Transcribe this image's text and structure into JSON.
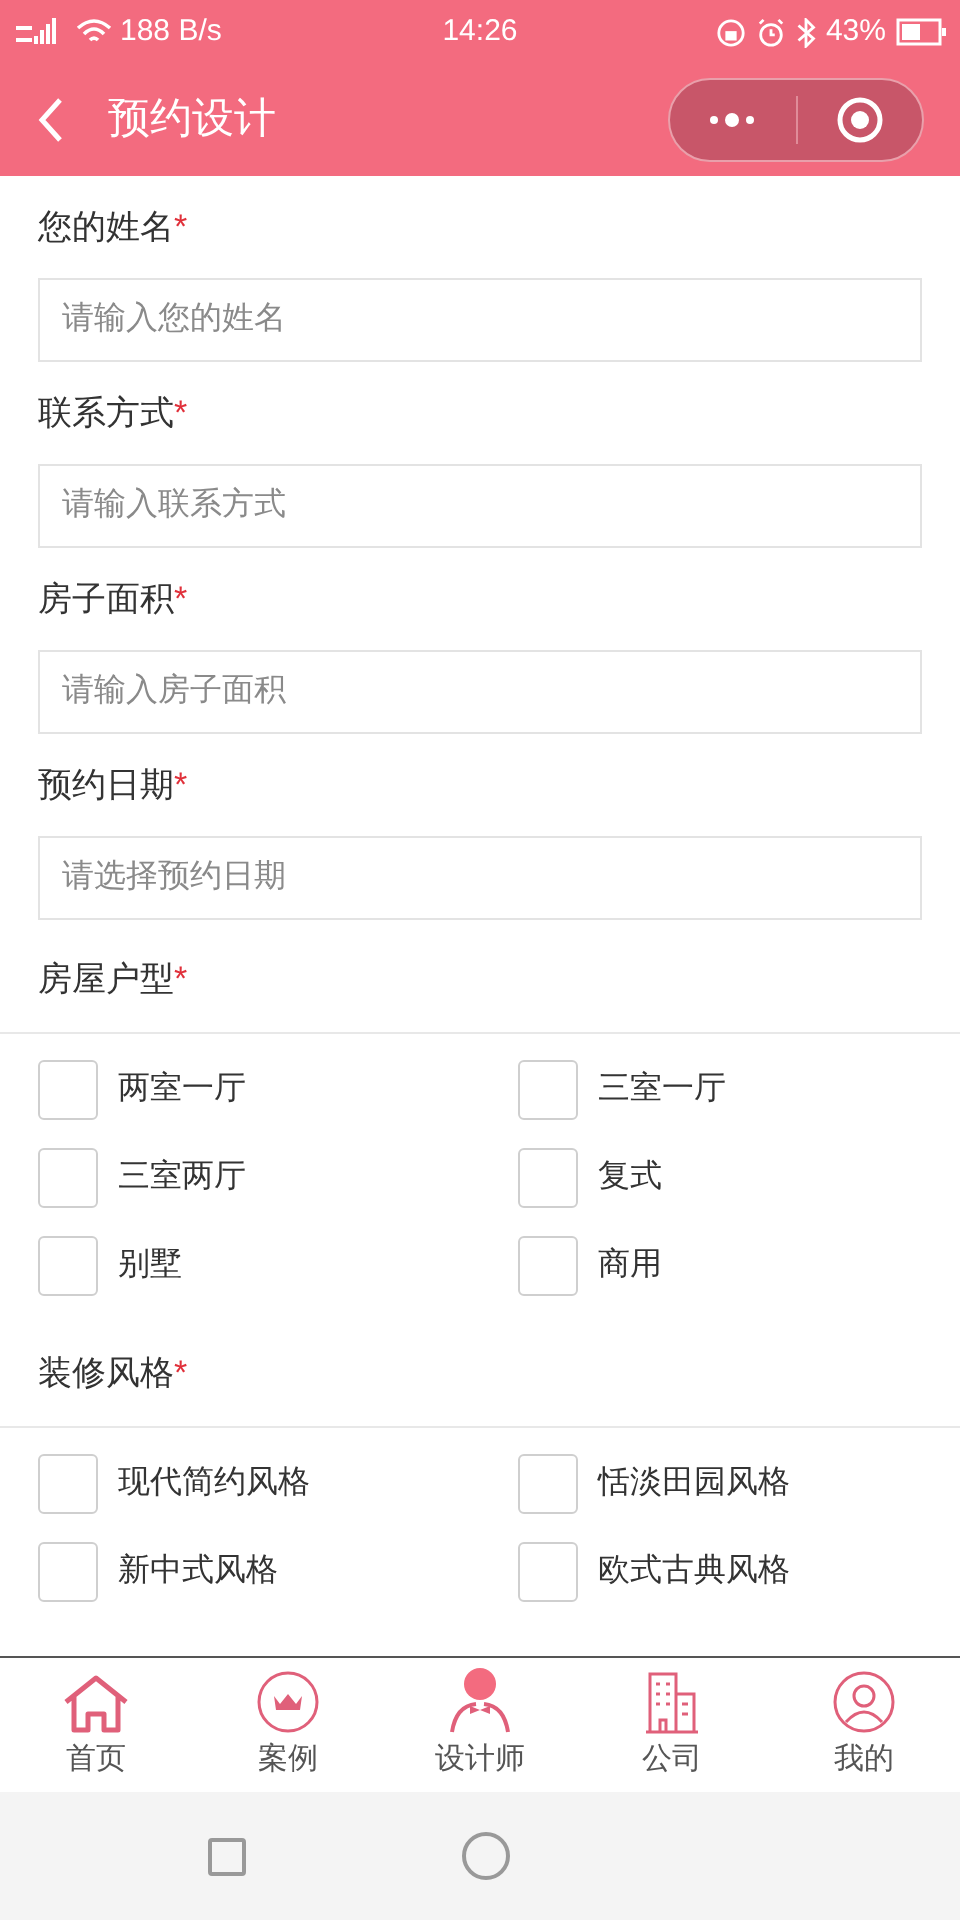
{
  "status_bar": {
    "network": "188 B/s",
    "time": "14:26",
    "battery": "43%"
  },
  "header": {
    "title": "预约设计"
  },
  "fields": [
    {
      "label": "您的姓名",
      "required_mark": "*",
      "placeholder": "请输入您的姓名"
    },
    {
      "label": "联系方式",
      "required_mark": "*",
      "placeholder": "请输入联系方式"
    },
    {
      "label": "房子面积",
      "required_mark": "*",
      "placeholder": "请输入房子面积"
    },
    {
      "label": "预约日期",
      "required_mark": "*",
      "placeholder": "请选择预约日期"
    }
  ],
  "groups": [
    {
      "label": "房屋户型",
      "required_mark": "*",
      "options": [
        {
          "label": "两室一厅",
          "checked": false
        },
        {
          "label": "三室一厅",
          "checked": false
        },
        {
          "label": "三室两厅",
          "checked": false
        },
        {
          "label": "复式",
          "checked": false
        },
        {
          "label": "别墅",
          "checked": false
        },
        {
          "label": "商用",
          "checked": false
        }
      ]
    },
    {
      "label": "装修风格",
      "required_mark": "*",
      "options": [
        {
          "label": "现代简约风格",
          "checked": false
        },
        {
          "label": "恬淡田园风格",
          "checked": false
        },
        {
          "label": "新中式风格",
          "checked": false
        },
        {
          "label": "欧式古典风格",
          "checked": false
        }
      ]
    }
  ],
  "tab_bar": [
    {
      "label": "首页"
    },
    {
      "label": "案例"
    },
    {
      "label": "设计师"
    },
    {
      "label": "公司"
    },
    {
      "label": "我的"
    }
  ]
}
